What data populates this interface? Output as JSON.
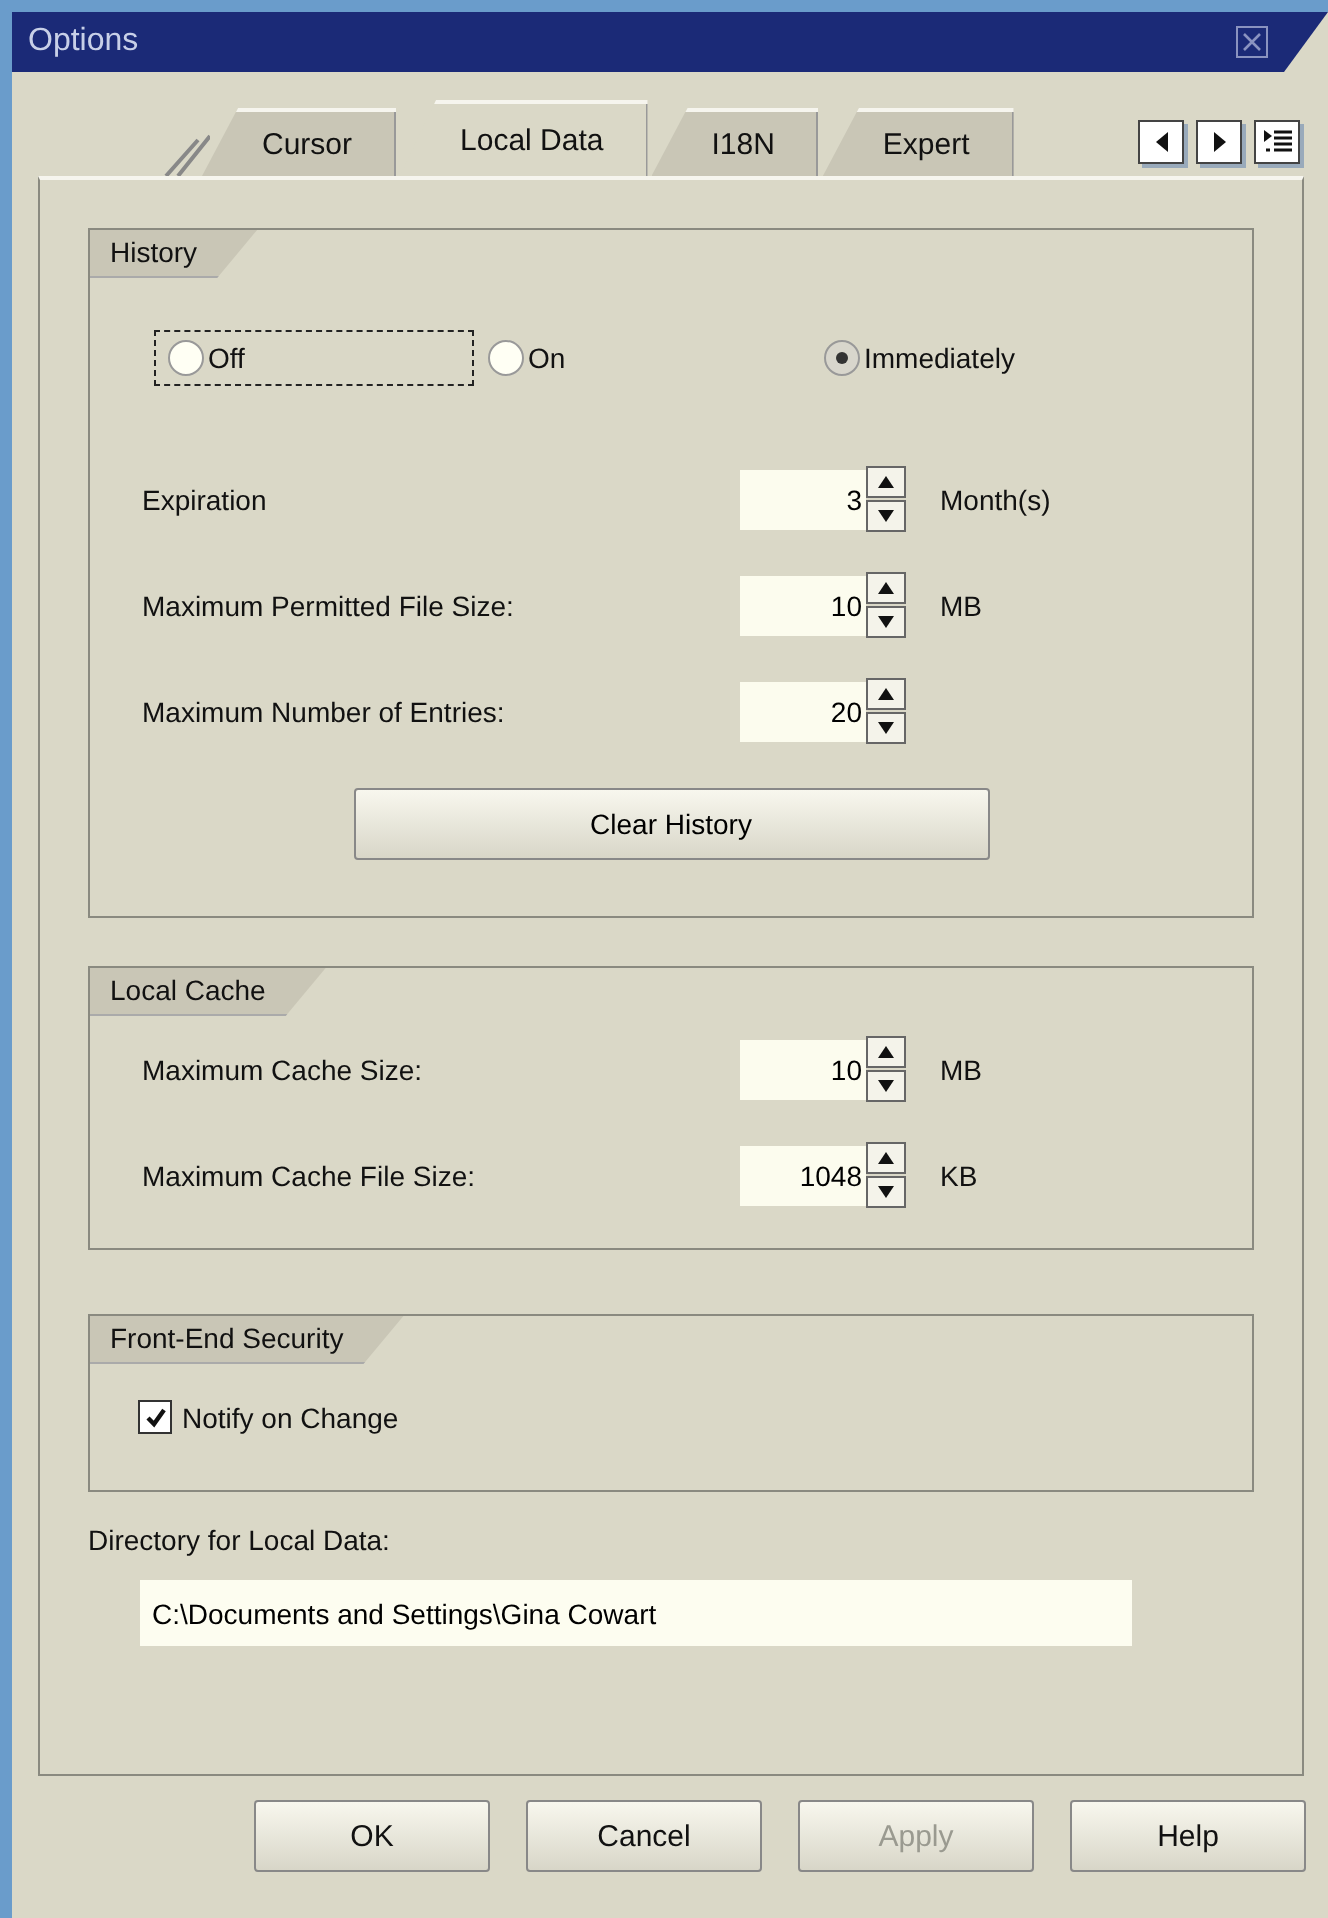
{
  "window": {
    "title": "Options"
  },
  "tabs": [
    {
      "label": "Cursor",
      "selected": false
    },
    {
      "label": "Local Data",
      "selected": true
    },
    {
      "label": "I18N",
      "selected": false
    },
    {
      "label": "Expert",
      "selected": false
    }
  ],
  "history": {
    "title": "History",
    "radios": [
      {
        "label": "Off",
        "selected": false,
        "focused": true
      },
      {
        "label": "On",
        "selected": false,
        "focused": false
      },
      {
        "label": "Immediately",
        "selected": true,
        "focused": false
      }
    ],
    "fields": [
      {
        "label": "Expiration",
        "value": "3",
        "unit": "Month(s)"
      },
      {
        "label": "Maximum Permitted File Size:",
        "value": "10",
        "unit": "MB"
      },
      {
        "label": "Maximum Number of Entries:",
        "value": "20"
      }
    ],
    "button": "Clear History"
  },
  "local_cache": {
    "title": "Local Cache",
    "fields": [
      {
        "label": "Maximum Cache Size:",
        "value": "10",
        "unit": "MB"
      },
      {
        "label": "Maximum Cache File Size:",
        "value": "1048",
        "unit": "KB"
      }
    ]
  },
  "front_end_security": {
    "title": "Front-End Security",
    "checkbox": {
      "label": "Notify on Change",
      "checked": true
    }
  },
  "directory": {
    "label": "Directory for Local Data:",
    "value": "C:\\Documents and Settings\\Gina Cowart"
  },
  "buttons": [
    {
      "label": "OK",
      "disabled": false
    },
    {
      "label": "Cancel",
      "disabled": false
    },
    {
      "label": "Apply",
      "disabled": true
    },
    {
      "label": "Help",
      "disabled": false
    }
  ]
}
